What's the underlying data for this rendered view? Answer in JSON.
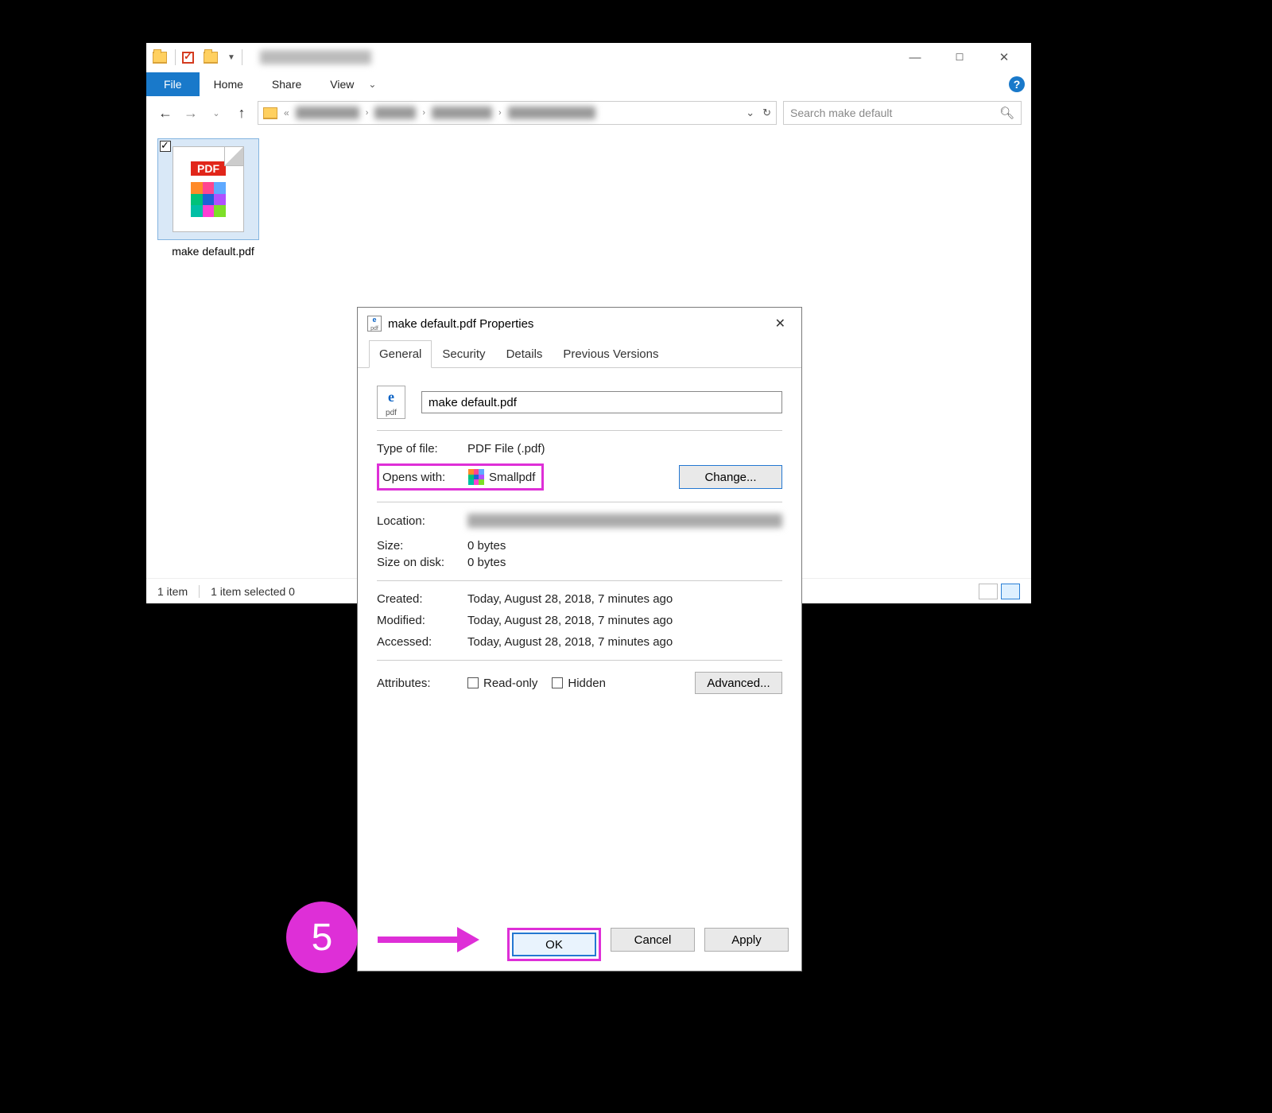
{
  "explorer": {
    "ribbon": {
      "file": "File",
      "home": "Home",
      "share": "Share",
      "view": "View"
    },
    "search_placeholder": "Search make default",
    "file_label": "make default.pdf",
    "pdf_badge": "PDF",
    "status_items": "1 item",
    "status_selected": "1 item selected  0"
  },
  "properties": {
    "title": "make default.pdf Properties",
    "tabs": {
      "general": "General",
      "security": "Security",
      "details": "Details",
      "previous": "Previous Versions"
    },
    "filename": "make default.pdf",
    "labels": {
      "type": "Type of file:",
      "opens": "Opens with:",
      "location": "Location:",
      "size": "Size:",
      "disk": "Size on disk:",
      "created": "Created:",
      "modified": "Modified:",
      "accessed": "Accessed:",
      "attributes": "Attributes:"
    },
    "values": {
      "type": "PDF File (.pdf)",
      "opens": "Smallpdf",
      "size": "0 bytes",
      "disk": "0 bytes",
      "created": "Today, August 28, 2018, 7 minutes ago",
      "modified": "Today, August 28, 2018, 7 minutes ago",
      "accessed": "Today, August 28, 2018, 7 minutes ago"
    },
    "buttons": {
      "change": "Change...",
      "advanced": "Advanced...",
      "ok": "OK",
      "cancel": "Cancel",
      "apply": "Apply"
    },
    "attr_readonly": "Read-only",
    "attr_hidden": "Hidden"
  },
  "annotation": {
    "step": "5"
  }
}
